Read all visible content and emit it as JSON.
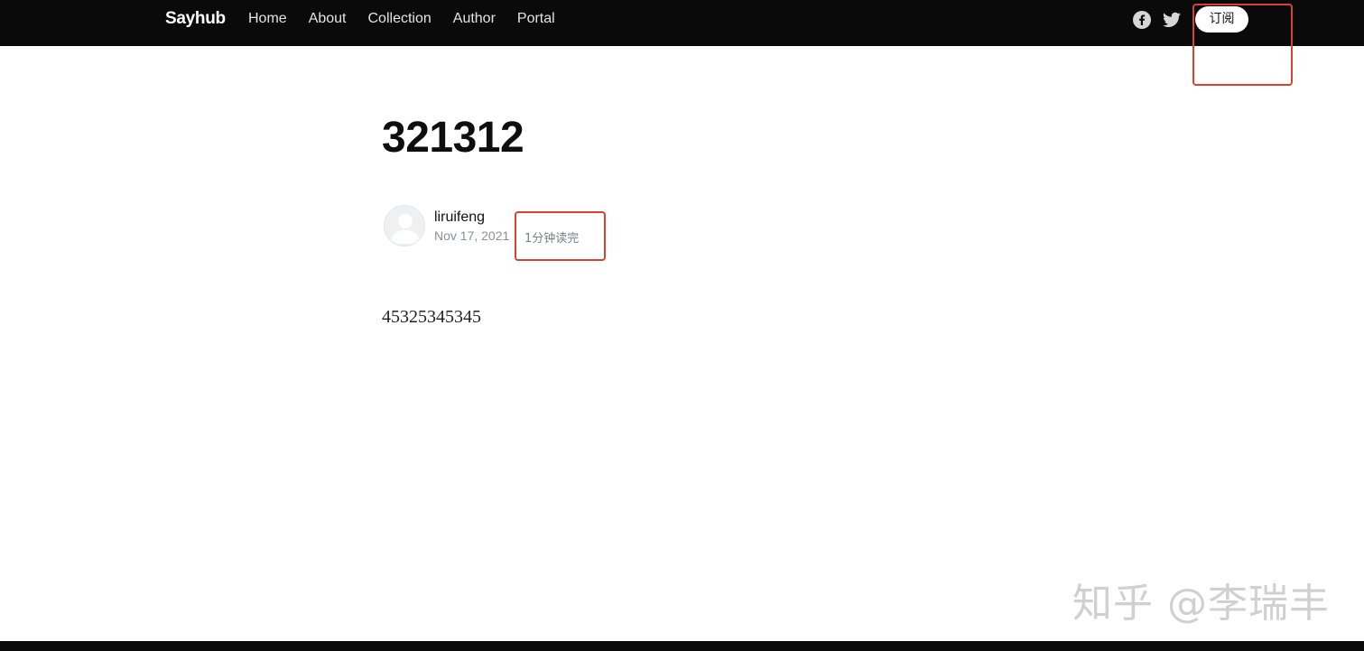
{
  "header": {
    "brand": "Sayhub",
    "nav": [
      "Home",
      "About",
      "Collection",
      "Author",
      "Portal"
    ],
    "subscribe_label": "订阅",
    "social": [
      "facebook-icon",
      "twitter-icon"
    ]
  },
  "post": {
    "title": "321312",
    "author": "liruifeng",
    "date": "Nov 17, 2021",
    "read_time": "1分钟读完",
    "body": "45325345345"
  },
  "watermark": "知乎 @李瑞丰",
  "colors": {
    "header_bg": "#0a0a0a",
    "highlight": "#d9432c",
    "meta_text": "#8a9096"
  }
}
